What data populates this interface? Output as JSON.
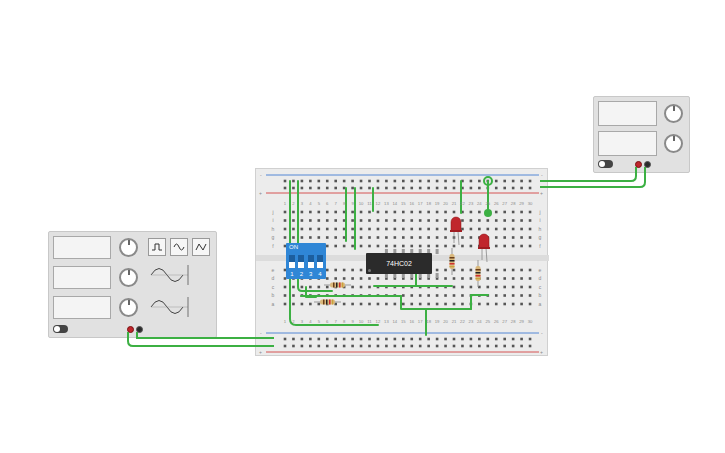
{
  "function_generator": {
    "power_on": false
  },
  "power_supply": {
    "power_on": false
  },
  "breadboard": {
    "columns": [
      "1",
      "2",
      "3",
      "4",
      "5",
      "6",
      "7",
      "8",
      "9",
      "10",
      "11",
      "12",
      "13",
      "14",
      "15",
      "16",
      "17",
      "18",
      "19",
      "20",
      "21",
      "22",
      "23",
      "24",
      "25",
      "26",
      "27",
      "28",
      "29",
      "30"
    ],
    "rows_top": [
      "j",
      "i",
      "h",
      "g",
      "f"
    ],
    "rows_bottom": [
      "e",
      "d",
      "c",
      "b",
      "a"
    ],
    "rail_minus": "-",
    "rail_plus": "+"
  },
  "dip_switch": {
    "label": "ON",
    "switches": [
      {
        "label": "1",
        "on": false
      },
      {
        "label": "2",
        "on": false
      },
      {
        "label": "3",
        "on": false
      },
      {
        "label": "4",
        "on": false
      }
    ]
  },
  "chip": {
    "label": "74HC02"
  },
  "leds": [
    {
      "lit": false
    },
    {
      "lit": false
    }
  ]
}
